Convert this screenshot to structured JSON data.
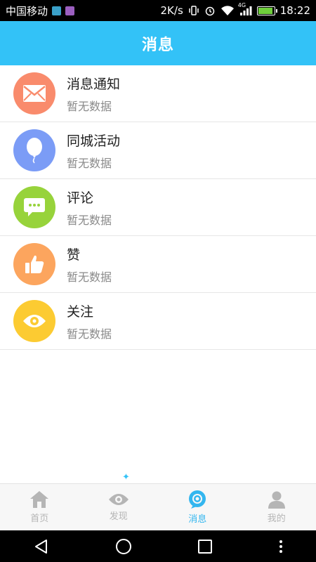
{
  "statusbar": {
    "carrier": "中国移动",
    "speed": "2K/s",
    "network": "4G",
    "time": "18:22"
  },
  "header": {
    "title": "消息"
  },
  "items": [
    {
      "title": "消息通知",
      "subtitle": "暂无数据",
      "icon": "mail-icon",
      "color": "#f98b6c"
    },
    {
      "title": "同城活动",
      "subtitle": "暂无数据",
      "icon": "balloon-icon",
      "color": "#7b9cf6"
    },
    {
      "title": "评论",
      "subtitle": "暂无数据",
      "icon": "comment-icon",
      "color": "#97d33b"
    },
    {
      "title": "赞",
      "subtitle": "暂无数据",
      "icon": "thumbs-up-icon",
      "color": "#fca55e"
    },
    {
      "title": "关注",
      "subtitle": "暂无数据",
      "icon": "eye-icon",
      "color": "#fccb32"
    }
  ],
  "tabs": [
    {
      "label": "首页",
      "icon": "home-icon",
      "active": false
    },
    {
      "label": "发现",
      "icon": "eye-icon",
      "active": false
    },
    {
      "label": "消息",
      "icon": "message-icon",
      "active": true
    },
    {
      "label": "我的",
      "icon": "user-icon",
      "active": false
    }
  ],
  "colors": {
    "accent": "#33c2f7",
    "active_tab": "#33b6ef",
    "inactive_tab": "#b5b5b5"
  }
}
